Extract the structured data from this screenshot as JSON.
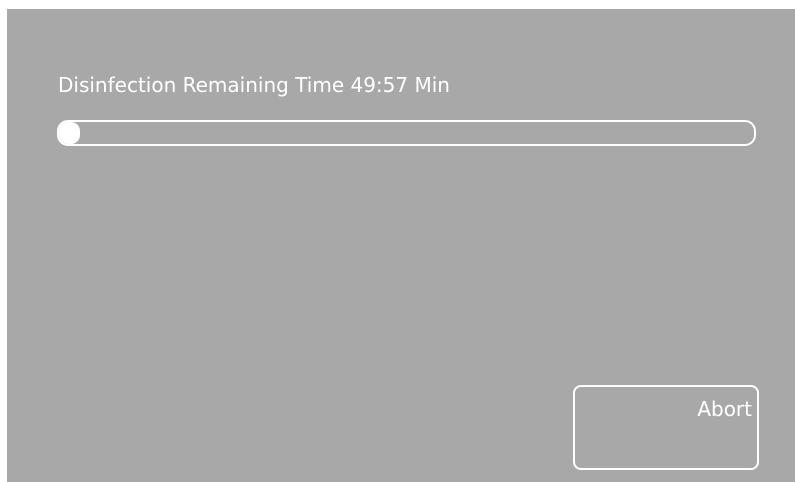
{
  "status": {
    "label": "Disinfection Remaining Time 49:57 Min",
    "progress_percent": 3
  },
  "actions": {
    "abort_label": "Abort"
  },
  "colors": {
    "background": "#a8a8a8",
    "foreground": "#ffffff"
  }
}
